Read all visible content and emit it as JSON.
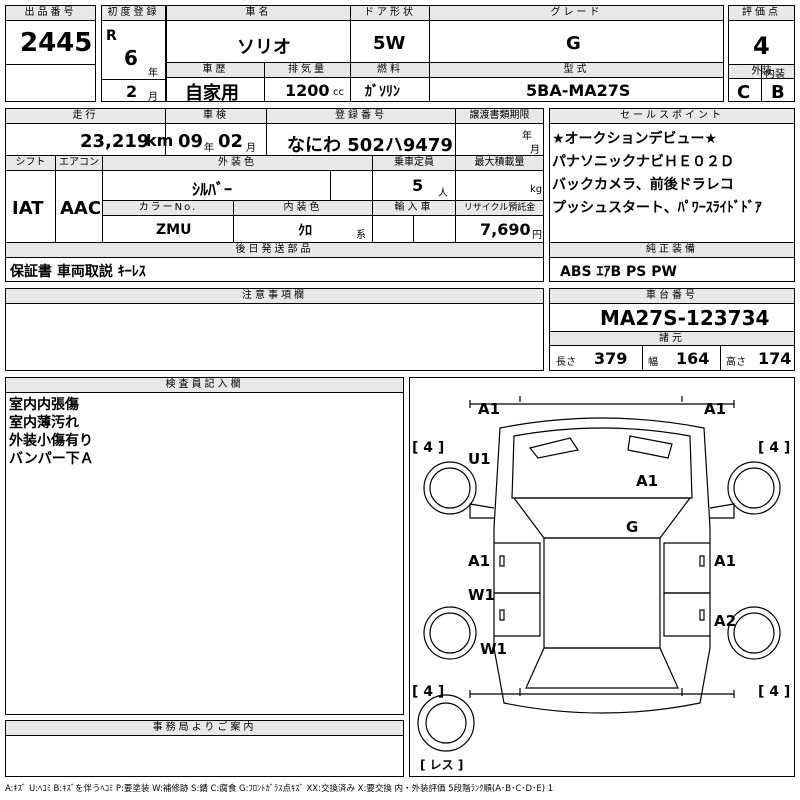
{
  "hdr": {
    "lot_label": "出品番号",
    "lot": "2445",
    "first_reg_label": "初度登録",
    "era": "R",
    "year": "6",
    "year_unit": "年",
    "month": "2",
    "month_unit": "月",
    "car_name_label": "車名",
    "car_name": "ソリオ",
    "door_label": "ドア形状",
    "door": "5W",
    "grade_label": "グレード",
    "grade": "G",
    "score_label": "評価点",
    "score": "4",
    "history_label": "車歴",
    "history": "自家用",
    "disp_label": "排気量",
    "disp": "1200",
    "disp_unit": "cc",
    "fuel_label": "燃料",
    "fuel": "ｶﾞｿﾘﾝ",
    "model_label": "型式",
    "model": "5BA-MA27S",
    "ext_label": "外装",
    "ext": "C",
    "int_label": "内装",
    "int": "B"
  },
  "row2": {
    "mileage_label": "走行",
    "mileage": "23,219",
    "mileage_unit": "km",
    "inspect_label": "車検",
    "inspect_y": "09",
    "inspect_y_unit": "年",
    "inspect_m": "02",
    "inspect_m_unit": "月",
    "reg_label": "登録番号",
    "reg": "なにわ 502ハ9479",
    "transfer_label": "譲渡書類期限",
    "transfer_y": "年",
    "transfer_m": "月",
    "shift_label": "シフト",
    "shift": "IAT",
    "ac_label": "エアコン",
    "ac": "AAC",
    "color_label": "外装色",
    "color": "ｼﾙﾊﾞｰ",
    "cap_label": "乗車定員",
    "cap": "5",
    "cap_unit": "人",
    "load_label": "最大積載量",
    "load_unit": "kg",
    "colorno_label": "カラーNo.",
    "colorno": "ZMU",
    "intcolor_label": "内装色",
    "intcolor": "ｸﾛ",
    "intcolor_unit": "系",
    "import_label": "輸入車",
    "recycle_label": "リサイクル預託金",
    "recycle": "7,690",
    "recycle_unit": "円"
  },
  "sales": {
    "label": "セールスポイント",
    "lines": [
      "★オークションデビュー★",
      "パナソニックナビＨＥ０２Ｄ",
      "バックカメラ、前後ドラレコ",
      "プッシュスタート、ﾊﾟﾜｰｽﾗｲﾄﾞﾄﾞｱ"
    ]
  },
  "shipping": {
    "label": "後日発送部品",
    "items": "保証書 車両取説 ｷｰﾚｽ"
  },
  "equipment": {
    "label": "純正装備",
    "items": "ABS ｴｱB PS PW"
  },
  "notes": {
    "label": "注意事項欄"
  },
  "chassis": {
    "label": "車台番号",
    "number": "MA27S-123734",
    "spec_label": "諸元",
    "len_label": "長さ",
    "len": "379",
    "wid_label": "幅",
    "wid": "164",
    "hgt_label": "高さ",
    "hgt": "174"
  },
  "inspector": {
    "label": "検査員記入欄",
    "lines": [
      "室内内張傷",
      "室内薄汚れ",
      "外装小傷有り",
      "バンパー下Ａ"
    ]
  },
  "office": {
    "label": "事務局よりご案内"
  },
  "diagram": {
    "marks": {
      "front_l": "A1",
      "front_r": "A1",
      "roof_front": "U1",
      "hood": "A1",
      "roof": "G",
      "left_front_door": "A1",
      "right_front_door": "A1",
      "left_rear_door": "W1",
      "right_rear_door": "A2",
      "left_rear_quarter": "W1"
    },
    "tire_fl": "4",
    "tire_fr": "4",
    "tire_rl": "4",
    "tire_rr": "4",
    "spare": "レス"
  },
  "legend": "A:ｷｽﾞ U:ﾍｺﾐ B:ｷｽﾞを伴うﾍｺﾐ P:要塗装 W:補修跡 S:錆 C:腐食 G:ﾌﾛﾝﾄｶﾞﾗｽ点ｷｽﾞ XX:交換済み X:要交換 内・外装評価 5段階ﾗﾝｸ順(A･B･C･D･E) 1"
}
